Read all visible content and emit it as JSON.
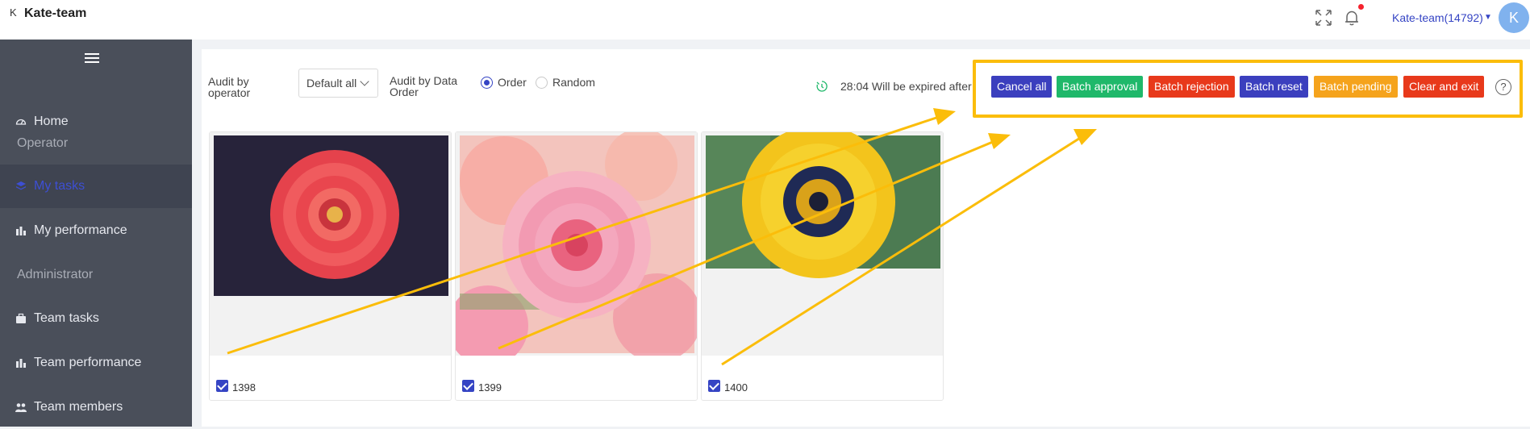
{
  "header": {
    "logo_mark": "K",
    "app_title": "Kate-team",
    "fullscreen_icon": "expand-arrows-icon",
    "notification_icon": "bell-icon",
    "user_label": "Kate-team(14792)",
    "avatar_letter": "K"
  },
  "sidebar": {
    "menu_icon": "hamburger-icon",
    "items": [
      {
        "label": "Home",
        "icon": "dashboard-icon",
        "active": false
      },
      {
        "label": "My tasks",
        "icon": "layers-icon",
        "active": true
      },
      {
        "label": "My performance",
        "icon": "bar-chart-icon",
        "active": false
      },
      {
        "label": "Team tasks",
        "icon": "briefcase-icon",
        "active": false
      },
      {
        "label": "Team performance",
        "icon": "bar-chart-icon",
        "active": false
      },
      {
        "label": "Team members",
        "icon": "users-icon",
        "active": false
      }
    ],
    "sections": [
      "Operator",
      "Administrator"
    ]
  },
  "toolbar": {
    "audit_operator_label": "Audit by operator",
    "operator_select_value": "Default all",
    "audit_order_label": "Audit by Data Order",
    "radio_order": "Order",
    "radio_random": "Random",
    "selected_order": "Order",
    "timer_text": "28:04 Will be expired after",
    "buttons": {
      "cancel_all": "Cancel all",
      "batch_approval": "Batch approval",
      "batch_rejection": "Batch rejection",
      "batch_reset": "Batch reset",
      "batch_pending": "Batch pending",
      "clear_exit": "Clear and exit"
    },
    "help": "?"
  },
  "cards": [
    {
      "id": "1398",
      "checked": true,
      "image": "red-zinnia-flower"
    },
    {
      "id": "1399",
      "checked": true,
      "image": "pink-dahlia-flowers"
    },
    {
      "id": "1400",
      "checked": true,
      "image": "yellow-daisy-flower"
    }
  ],
  "colors": {
    "accent": "#3544c4",
    "sidebar_bg": "#4a4f5a",
    "btn_blue": "#3b3fbe",
    "btn_green": "#1fb86a",
    "btn_red": "#e8391b",
    "btn_pending": "#f5a31c",
    "annotation": "#fbbd0a"
  }
}
